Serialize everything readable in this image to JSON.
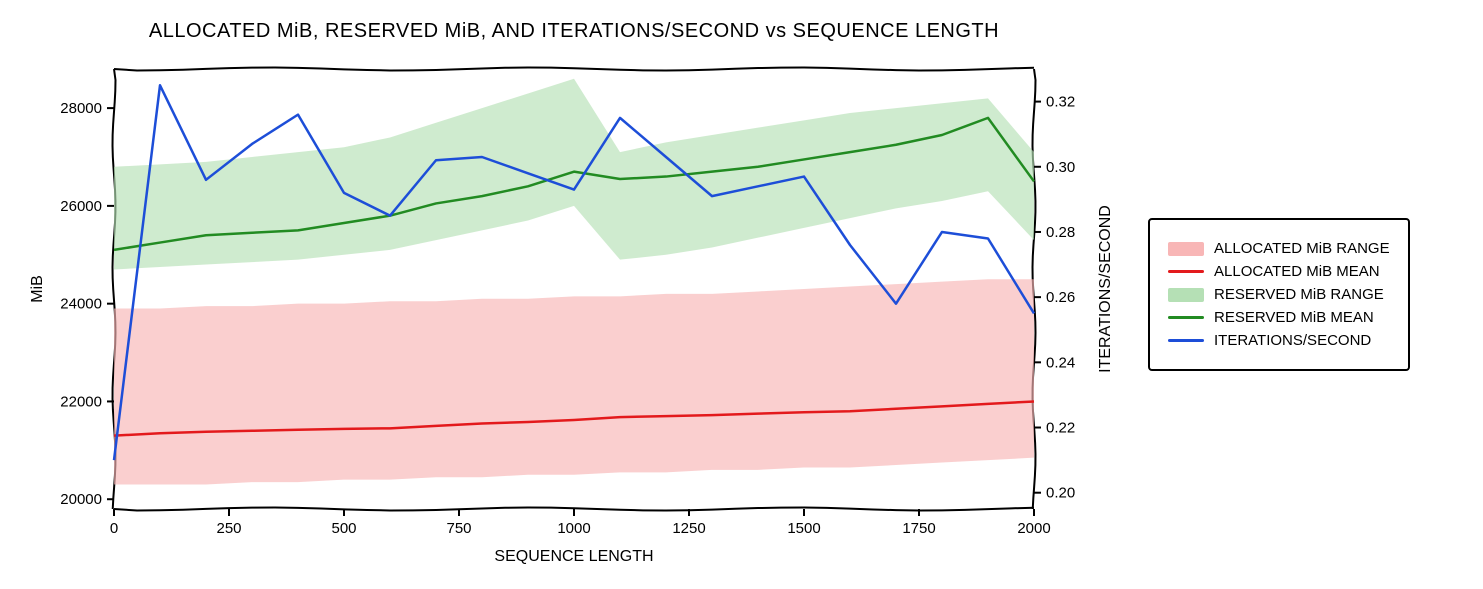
{
  "chart_data": {
    "type": "line",
    "title": "ALLOCATED MiB, RESERVED MiB, AND ITERATIONS/SECOND vs SEQUENCE LENGTH",
    "xlabel": "SEQUENCE LENGTH",
    "ylabel_left": "MiB",
    "ylabel_right": "ITERATIONS/SECOND",
    "x_ticks": [
      0,
      250,
      500,
      750,
      1000,
      1250,
      1500,
      1750,
      2000
    ],
    "y_left_ticks": [
      20000,
      22000,
      24000,
      26000,
      28000
    ],
    "y_left_range": [
      19800,
      28800
    ],
    "y_right_ticks": [
      0.2,
      0.22,
      0.24,
      0.26,
      0.28,
      0.3,
      0.32
    ],
    "y_right_range": [
      0.195,
      0.33
    ],
    "x": [
      0,
      100,
      200,
      300,
      400,
      500,
      600,
      700,
      800,
      900,
      1000,
      1100,
      1200,
      1300,
      1400,
      1500,
      1600,
      1700,
      1800,
      1900,
      2000
    ],
    "series": [
      {
        "name": "ALLOCATED MiB MEAN",
        "axis": "left",
        "color": "#e31a1c",
        "type": "line",
        "values": [
          21300,
          21350,
          21380,
          21400,
          21420,
          21440,
          21450,
          21500,
          21550,
          21580,
          21620,
          21680,
          21700,
          21720,
          21750,
          21780,
          21800,
          21850,
          21900,
          21950,
          22000
        ]
      },
      {
        "name": "RESERVED MiB MEAN",
        "axis": "left",
        "color": "#228b22",
        "type": "line",
        "values": [
          25100,
          25250,
          25400,
          25450,
          25500,
          25650,
          25800,
          26050,
          26200,
          26400,
          26700,
          26550,
          26600,
          26700,
          26800,
          26950,
          27100,
          27250,
          27450,
          27800,
          26500
        ]
      },
      {
        "name": "ALLOCATED MiB RANGE",
        "axis": "left",
        "color": "#f8b6b6",
        "type": "band",
        "low": [
          20300,
          20300,
          20300,
          20350,
          20350,
          20400,
          20400,
          20450,
          20450,
          20500,
          20500,
          20550,
          20550,
          20600,
          20600,
          20650,
          20650,
          20700,
          20750,
          20800,
          20850
        ],
        "high": [
          23900,
          23900,
          23950,
          23950,
          24000,
          24000,
          24050,
          24050,
          24100,
          24100,
          24150,
          24150,
          24200,
          24200,
          24250,
          24300,
          24350,
          24400,
          24450,
          24500,
          24500
        ]
      },
      {
        "name": "RESERVED MiB RANGE",
        "axis": "left",
        "color": "#b5e0b5",
        "type": "band",
        "low": [
          24700,
          24750,
          24800,
          24850,
          24900,
          25000,
          25100,
          25300,
          25500,
          25700,
          26000,
          24900,
          25000,
          25150,
          25350,
          25550,
          25750,
          25950,
          26100,
          26300,
          25300
        ],
        "high": [
          26800,
          26850,
          26900,
          27000,
          27100,
          27200,
          27400,
          27700,
          28000,
          28300,
          28600,
          27100,
          27300,
          27450,
          27600,
          27750,
          27900,
          28000,
          28100,
          28200,
          27100
        ]
      },
      {
        "name": "ITERATIONS/SECOND",
        "axis": "right",
        "color": "#1d4ed8",
        "type": "line",
        "values": [
          0.21,
          0.325,
          0.296,
          0.307,
          0.316,
          0.292,
          0.285,
          0.302,
          0.303,
          0.298,
          0.293,
          0.315,
          0.303,
          0.291,
          0.294,
          0.297,
          0.276,
          0.258,
          0.28,
          0.278,
          0.255
        ]
      }
    ],
    "legend": [
      {
        "label": "ALLOCATED MiB RANGE",
        "kind": "fill",
        "color": "#f8b6b6"
      },
      {
        "label": "ALLOCATED MiB MEAN",
        "kind": "line",
        "color": "#e31a1c"
      },
      {
        "label": "RESERVED MiB RANGE",
        "kind": "fill",
        "color": "#b5e0b5"
      },
      {
        "label": "RESERVED MiB MEAN",
        "kind": "line",
        "color": "#228b22"
      },
      {
        "label": "ITERATIONS/SECOND",
        "kind": "line",
        "color": "#1d4ed8"
      }
    ]
  }
}
